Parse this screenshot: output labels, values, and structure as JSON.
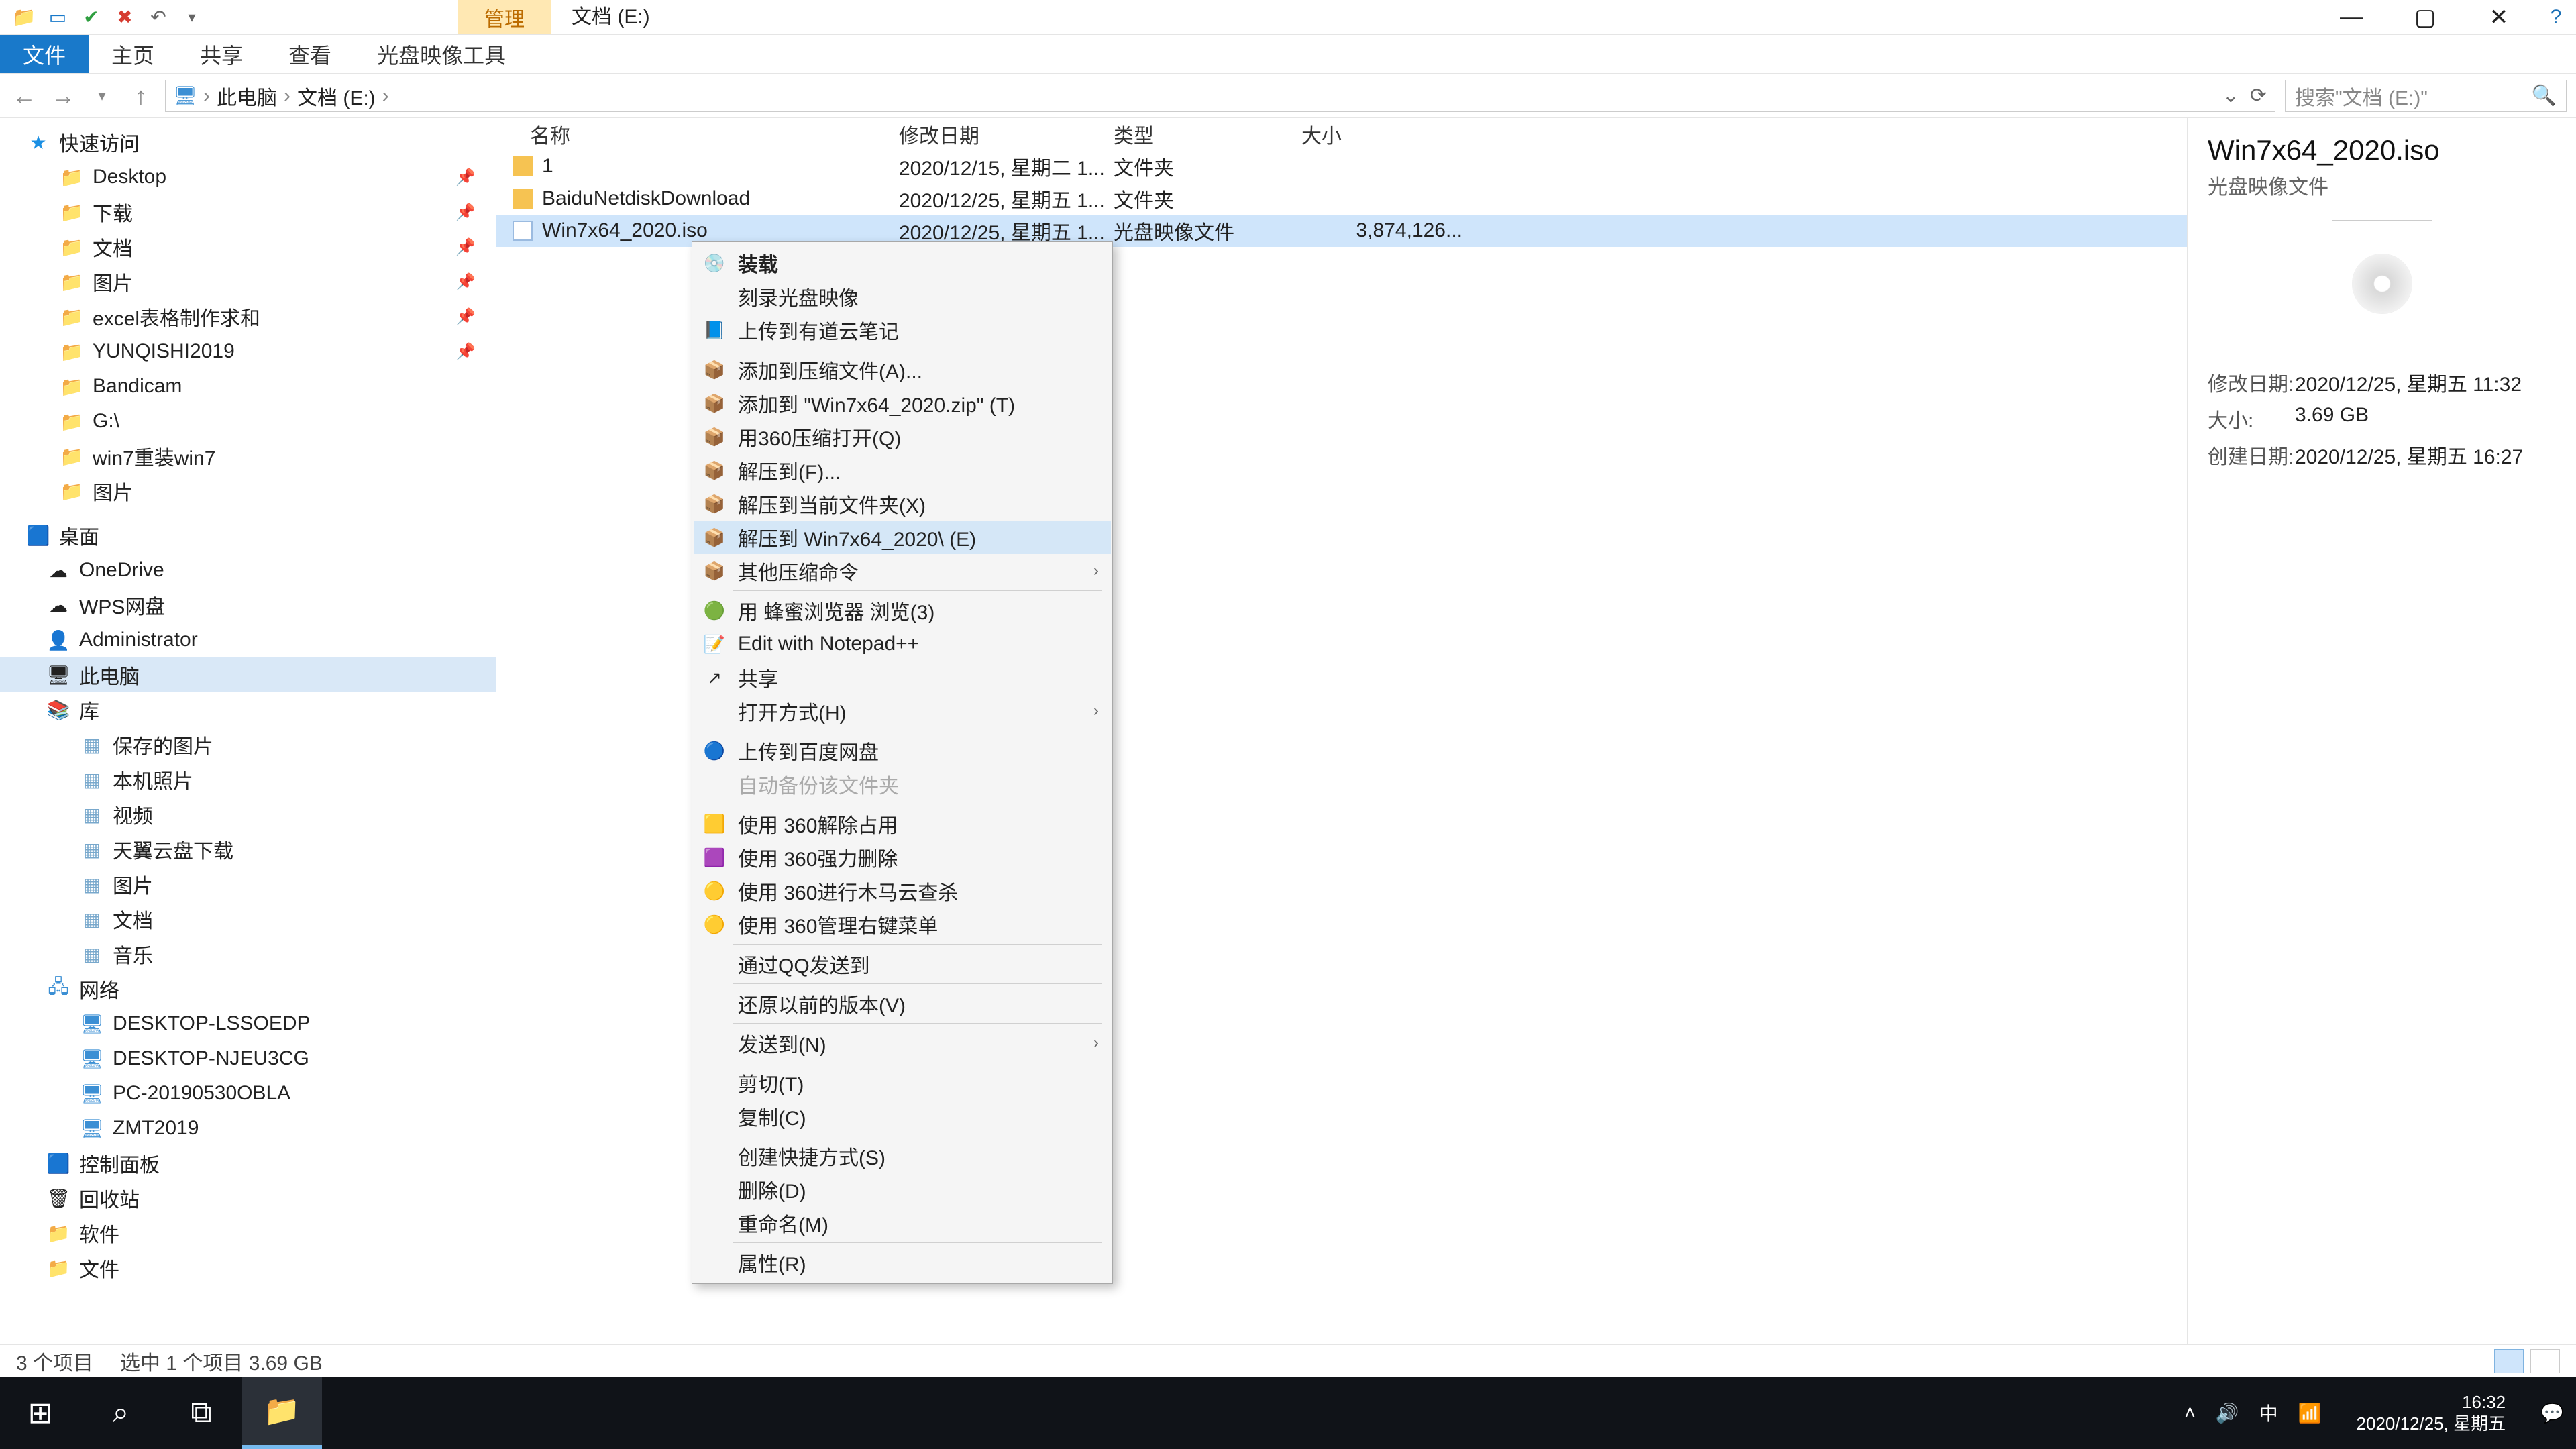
{
  "titlebar": {
    "contextual_tab": "管理",
    "window_title": "文档 (E:)"
  },
  "ribbon": {
    "tabs": [
      "文件",
      "主页",
      "共享",
      "查看",
      "光盘映像工具"
    ]
  },
  "nav": {
    "crumbs": [
      "此电脑",
      "文档 (E:)"
    ],
    "search_placeholder": "搜索\"文档 (E:)\""
  },
  "tree": {
    "quick_access": "快速访问",
    "quick_items": [
      {
        "label": "Desktop",
        "pinned": true
      },
      {
        "label": "下载",
        "pinned": true
      },
      {
        "label": "文档",
        "pinned": true
      },
      {
        "label": "图片",
        "pinned": true
      },
      {
        "label": "excel表格制作求和",
        "pinned": true
      },
      {
        "label": "YUNQISHI2019",
        "pinned": true
      },
      {
        "label": "Bandicam",
        "pinned": false
      },
      {
        "label": "G:\\",
        "pinned": false
      },
      {
        "label": "win7重装win7",
        "pinned": false
      },
      {
        "label": "图片",
        "pinned": false
      }
    ],
    "desktop": "桌面",
    "desktop_items": [
      "OneDrive",
      "WPS网盘",
      "Administrator",
      "此电脑",
      "库"
    ],
    "lib_items": [
      "保存的图片",
      "本机照片",
      "视频",
      "天翼云盘下载",
      "图片",
      "文档",
      "音乐"
    ],
    "network": "网络",
    "net_items": [
      "DESKTOP-LSSOEDP",
      "DESKTOP-NJEU3CG",
      "PC-20190530OBLA",
      "ZMT2019"
    ],
    "ctrl_panel": "控制面板",
    "recycle": "回收站",
    "soft": "软件",
    "docs": "文件"
  },
  "columns": {
    "name": "名称",
    "date": "修改日期",
    "type": "类型",
    "size": "大小"
  },
  "files": [
    {
      "name": "1",
      "date": "2020/12/15, 星期二 1...",
      "type": "文件夹",
      "size": "",
      "icon": "folder"
    },
    {
      "name": "BaiduNetdiskDownload",
      "date": "2020/12/25, 星期五 1...",
      "type": "文件夹",
      "size": "",
      "icon": "folder"
    },
    {
      "name": "Win7x64_2020.iso",
      "date": "2020/12/25, 星期五 1...",
      "type": "光盘映像文件",
      "size": "3,874,126...",
      "icon": "iso",
      "selected": true
    }
  ],
  "context_menu": [
    {
      "label": "装载",
      "bold": true,
      "icon": "💿"
    },
    {
      "label": "刻录光盘映像"
    },
    {
      "label": "上传到有道云笔记",
      "icon": "📘"
    },
    {
      "sep": true
    },
    {
      "label": "添加到压缩文件(A)...",
      "icon": "📦"
    },
    {
      "label": "添加到 \"Win7x64_2020.zip\" (T)",
      "icon": "📦"
    },
    {
      "label": "用360压缩打开(Q)",
      "icon": "📦"
    },
    {
      "label": "解压到(F)...",
      "icon": "📦"
    },
    {
      "label": "解压到当前文件夹(X)",
      "icon": "📦"
    },
    {
      "label": "解压到 Win7x64_2020\\ (E)",
      "icon": "📦",
      "hover": true
    },
    {
      "label": "其他压缩命令",
      "icon": "📦",
      "submenu": true
    },
    {
      "sep": true
    },
    {
      "label": "用 蜂蜜浏览器 浏览(3)",
      "icon": "🟢"
    },
    {
      "label": "Edit with Notepad++",
      "icon": "📝"
    },
    {
      "label": "共享",
      "icon": "↗"
    },
    {
      "label": "打开方式(H)",
      "submenu": true
    },
    {
      "sep": true
    },
    {
      "label": "上传到百度网盘",
      "icon": "🔵"
    },
    {
      "label": "自动备份该文件夹",
      "disabled": true
    },
    {
      "sep": true
    },
    {
      "label": "使用 360解除占用",
      "icon": "🟨"
    },
    {
      "label": "使用 360强力删除",
      "icon": "🟪"
    },
    {
      "label": "使用 360进行木马云查杀",
      "icon": "🟡"
    },
    {
      "label": "使用 360管理右键菜单",
      "icon": "🟡"
    },
    {
      "sep": true
    },
    {
      "label": "通过QQ发送到"
    },
    {
      "sep": true
    },
    {
      "label": "还原以前的版本(V)"
    },
    {
      "sep": true
    },
    {
      "label": "发送到(N)",
      "submenu": true
    },
    {
      "sep": true
    },
    {
      "label": "剪切(T)"
    },
    {
      "label": "复制(C)"
    },
    {
      "sep": true
    },
    {
      "label": "创建快捷方式(S)"
    },
    {
      "label": "删除(D)"
    },
    {
      "label": "重命名(M)"
    },
    {
      "sep": true
    },
    {
      "label": "属性(R)"
    }
  ],
  "details": {
    "title": "Win7x64_2020.iso",
    "subtitle": "光盘映像文件",
    "meta": [
      {
        "label": "修改日期:",
        "value": "2020/12/25, 星期五 11:32"
      },
      {
        "label": "大小:",
        "value": "3.69 GB"
      },
      {
        "label": "创建日期:",
        "value": "2020/12/25, 星期五 16:27"
      }
    ]
  },
  "status": {
    "count": "3 个项目",
    "selected": "选中 1 个项目  3.69 GB"
  },
  "taskbar": {
    "time": "16:32",
    "date": "2020/12/25, 星期五",
    "ime": "中"
  }
}
